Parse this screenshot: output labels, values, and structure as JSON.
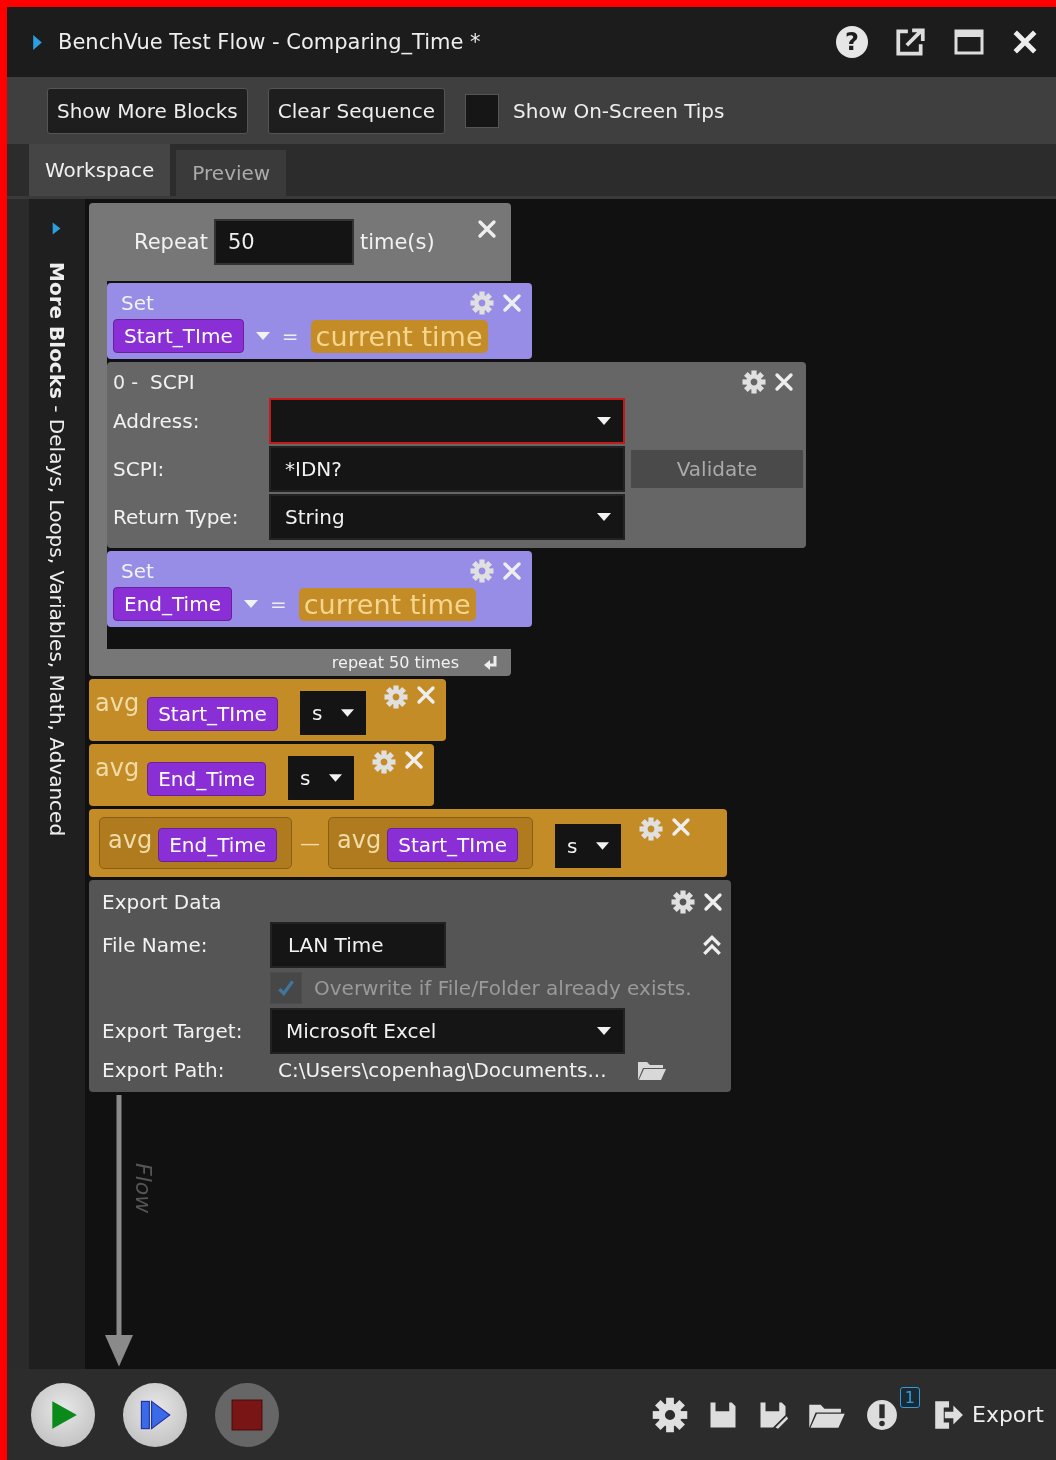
{
  "window": {
    "title": "BenchVue Test Flow - Comparing_Time *",
    "help_glyph": "?"
  },
  "toolbar": {
    "buttons": [
      "Show More Blocks",
      "Clear Sequence"
    ],
    "tips": {
      "label": "Show On-Screen Tips",
      "checked": false
    }
  },
  "tabs": [
    {
      "label": "Workspace",
      "selected": true
    },
    {
      "label": "Preview",
      "selected": false
    }
  ],
  "sidebar": {
    "label": "**More Blocks** - Delays, Loops, Variables, Math, Advanced",
    "expanded": false
  },
  "workspace": {
    "repeat": {
      "label": "Repeat",
      "count": "50",
      "unit": "time(s)",
      "footer": "repeat 50 times",
      "blocks": [
        {
          "kind": "set",
          "label": "Set",
          "variable": "Start_TIme",
          "operator": "=",
          "value": "current time"
        },
        {
          "kind": "scpi",
          "index": "0 -",
          "title": "SCPI",
          "address_label": "Address:",
          "address_invalid": true,
          "command_label": "SCPI:",
          "command": "*IDN?",
          "validate": {
            "label": "Validate",
            "disabled": true
          },
          "return_label": "Return Type:",
          "return_type": "String"
        },
        {
          "kind": "set",
          "label": "Set",
          "variable": "End_Time",
          "operator": "=",
          "value": "current time"
        }
      ]
    },
    "blocks": [
      {
        "kind": "avg",
        "label": "avg",
        "variable": "Start_TIme",
        "unit": "s"
      },
      {
        "kind": "avg",
        "label": "avg",
        "variable": "End_Time",
        "unit": "s"
      },
      {
        "kind": "difference",
        "left": {
          "label": "avg",
          "variable": "End_Time"
        },
        "operator": "—",
        "right": {
          "label": "avg",
          "variable": "Start_TIme"
        },
        "unit": "s"
      },
      {
        "kind": "export",
        "title": "Export Data",
        "file_label": "File Name:",
        "file_name": "LAN Time",
        "overwrite": {
          "label": "Overwrite if File/Folder already exists.",
          "checked": true,
          "disabled": true
        },
        "target_label": "Export Target:",
        "target": "Microsoft Excel",
        "path_label": "Export Path:",
        "path": "C:\\Users\\copenhag\\Documents..."
      }
    ],
    "flow_label": "Flow"
  },
  "bottom_bar": {
    "alert_count": "1",
    "export": "Export"
  }
}
